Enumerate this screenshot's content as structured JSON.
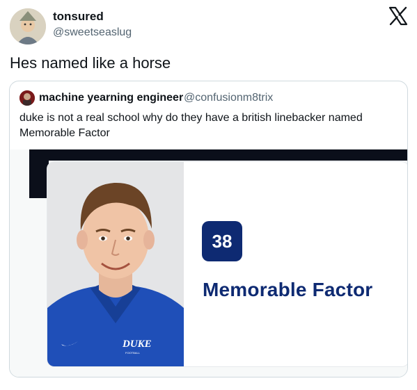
{
  "tweet": {
    "display_name": "tonsured",
    "handle": "@sweetseaslug",
    "text": "Hes named like a horse"
  },
  "brand": {
    "icon": "x-logo-icon"
  },
  "quoted_tweet": {
    "display_name": "machine yearning engineer",
    "handle": "@confusionm8trix",
    "text": "duke is not a real school why do they have a british linebacker named Memorable Factor"
  },
  "player_card": {
    "number": "38",
    "name": "Memorable Factor",
    "jersey_text": "DUKE",
    "jersey_subtext": "FOOTBALL",
    "accent_color": "#0e2a72",
    "jersey_color": "#1f4fb8"
  }
}
